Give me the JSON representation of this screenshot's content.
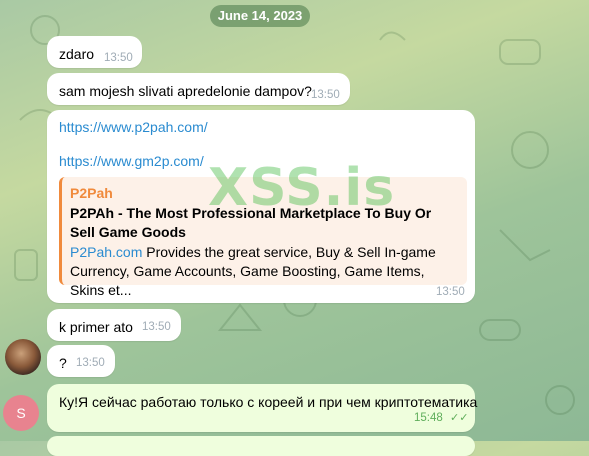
{
  "chat": {
    "date": "June 14, 2023",
    "messages": [
      {
        "text": "zdaro",
        "time": "13:50"
      },
      {
        "text": "sam mojesh slivati apredelonie dampov?",
        "time": "13:50"
      },
      {
        "links": [
          "https://www.p2pah.com/",
          "https://www.gm2p.com/"
        ],
        "time": "13:50",
        "preview": {
          "site": "P2Pah",
          "title": "P2PAh - The Most Professional Marketplace To Buy Or Sell Game Goods",
          "desc_link": "P2Pah.com",
          "desc_line1": " Provides the great service, Buy & Sell In-game",
          "desc_line2": "Currency, Game Accounts, Game Boosting, Game Items, Skins et..."
        }
      },
      {
        "text": "k primer ato",
        "time": "13:50"
      },
      {
        "text": "?",
        "time": "13:50"
      },
      {
        "text": "Ку!Я сейчас работаю только с кореей и при чем криптотематика",
        "time": "15:48"
      }
    ]
  },
  "avatars": {
    "second_user_initial": "S"
  },
  "watermark": "XSS.is",
  "colors": {
    "link": "#2a8bd0",
    "preview_accent": "#f08a3c",
    "outgoing_bubble": "#effedd"
  }
}
